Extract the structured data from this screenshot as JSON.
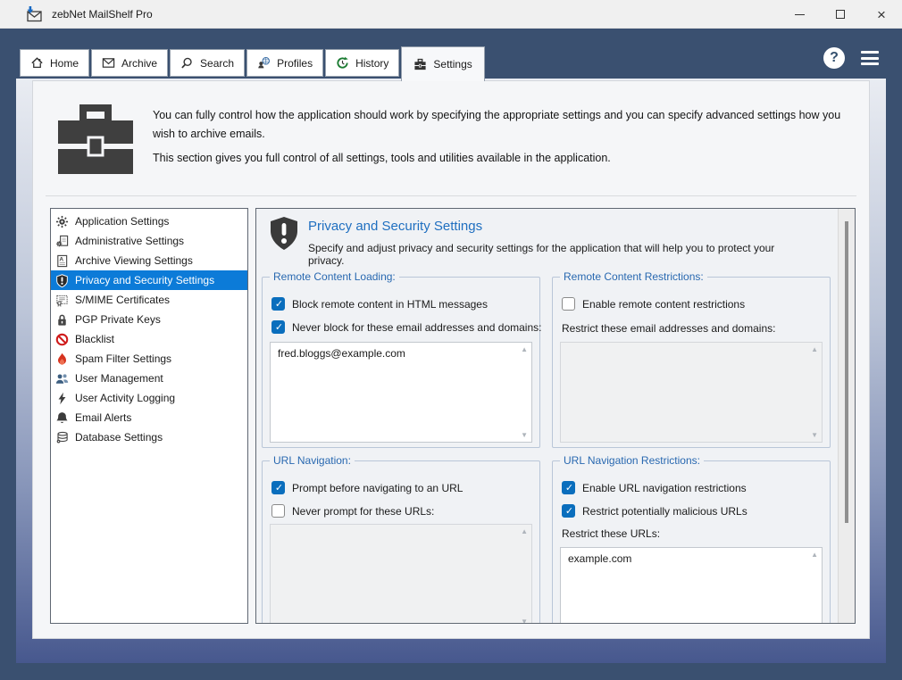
{
  "window": {
    "title": "zebNet MailShelf Pro"
  },
  "titlebar_icons": [
    "app-mail-icon",
    "minimize-icon",
    "maximize-icon",
    "close-icon"
  ],
  "tabs": {
    "active_index": 5,
    "items": [
      {
        "label": "Home",
        "icon": "home-icon"
      },
      {
        "label": "Archive",
        "icon": "envelope-icon"
      },
      {
        "label": "Search",
        "icon": "search-icon"
      },
      {
        "label": "Profiles",
        "icon": "profiles-globe-icon"
      },
      {
        "label": "History",
        "icon": "history-icon"
      },
      {
        "label": "Settings",
        "icon": "briefcase-icon"
      }
    ]
  },
  "menu_icons": [
    "help-icon",
    "hamburger-menu-icon"
  ],
  "header": {
    "intro": "You can fully control how the application should work by specifying the appropriate settings and you can specify advanced settings how you wish to archive emails.",
    "section_note": "This section gives you full control of all settings, tools and utilities available in the application.",
    "icon": "briefcase-icon"
  },
  "sidebar": {
    "selected_index": 3,
    "items": [
      {
        "label": "Application Settings",
        "icon": "gear-icon"
      },
      {
        "label": "Administrative Settings",
        "icon": "gear-document-icon"
      },
      {
        "label": "Archive Viewing Settings",
        "icon": "document-a-icon"
      },
      {
        "label": "Privacy and Security Settings",
        "icon": "shield-exclamation-icon"
      },
      {
        "label": "S/MIME Certificates",
        "icon": "certificate-icon"
      },
      {
        "label": "PGP Private Keys",
        "icon": "padlock-icon"
      },
      {
        "label": "Blacklist",
        "icon": "no-entry-icon"
      },
      {
        "label": "Spam Filter Settings",
        "icon": "flame-icon"
      },
      {
        "label": "User Management",
        "icon": "users-icon"
      },
      {
        "label": "User Activity Logging",
        "icon": "lightning-icon"
      },
      {
        "label": "Email Alerts",
        "icon": "bell-icon"
      },
      {
        "label": "Database Settings",
        "icon": "database-gear-icon"
      }
    ]
  },
  "panel": {
    "icon": "shield-exclamation-icon",
    "title": "Privacy and Security Settings",
    "subtitle": "Specify and adjust privacy and security settings for the application that will help you to protect your privacy.",
    "groups": [
      {
        "title": "Remote Content Loading:",
        "checkboxes": [
          {
            "label": "Block remote content in HTML messages",
            "checked": true
          },
          {
            "label": "Never block for these email addresses and domains:",
            "checked": true
          }
        ],
        "textarea": {
          "value": "fred.bloggs@example.com",
          "enabled": true
        }
      },
      {
        "title": "Remote Content Restrictions:",
        "checkboxes": [
          {
            "label": "Enable remote content restrictions",
            "checked": false
          }
        ],
        "field_label": "Restrict these email addresses and domains:",
        "textarea": {
          "value": "",
          "enabled": false
        }
      },
      {
        "title": "URL Navigation:",
        "checkboxes": [
          {
            "label": "Prompt before navigating to an URL",
            "checked": true
          },
          {
            "label": "Never prompt for these URLs:",
            "checked": false
          }
        ],
        "textarea": {
          "value": "",
          "enabled": false
        }
      },
      {
        "title": "URL Navigation Restrictions:",
        "checkboxes": [
          {
            "label": "Enable URL navigation restrictions",
            "checked": true
          },
          {
            "label": "Restrict potentially malicious URLs",
            "checked": true
          }
        ],
        "field_label": "Restrict these URLs:",
        "textarea": {
          "value": "example.com",
          "enabled": true
        }
      }
    ]
  },
  "colors": {
    "titlebar_bg": "#f0f0f0",
    "frame_navy": "#3a5070",
    "card_bg": "#f5f6f8",
    "panel_bg": "#f0f2f5",
    "heading_blue": "#1f6fc0",
    "group_label_blue": "#2868b0",
    "selection_blue": "#0c7bd8",
    "checkbox_blue": "#0a6ebd",
    "alert_red": "#d6331f"
  }
}
